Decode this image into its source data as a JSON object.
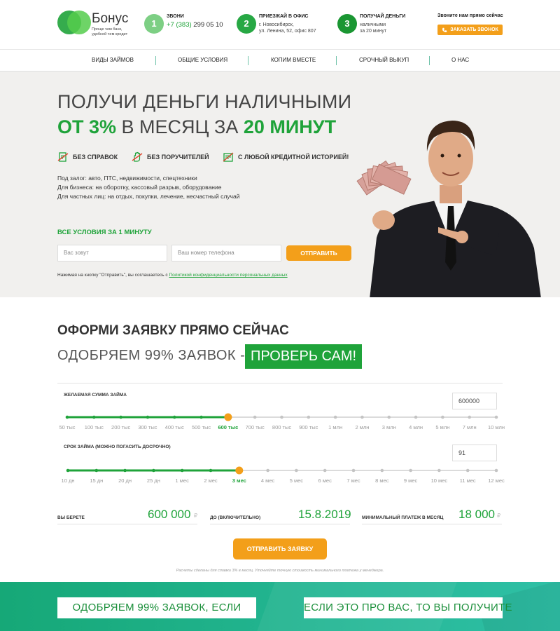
{
  "header": {
    "logo": {
      "name": "Бонус",
      "slogan": "Проще чем банк, удобней чем кредит"
    },
    "steps": [
      {
        "num": "1",
        "title": "ЗВОНИ",
        "phone_code": "+7 (383)",
        "phone_rest": " 299 05 10"
      },
      {
        "num": "2",
        "title": "ПРИЕЗЖАЙ В ОФИС",
        "line1": "г. Новосибирск,",
        "line2": "ул. Ленина, 52, офис 807"
      },
      {
        "num": "3",
        "title": "ПОЛУЧАЙ ДЕНЬГИ",
        "line1": "наличными",
        "line2": "за 20 минут"
      }
    ],
    "callbox": {
      "title": "Звоните нам прямо сейчас",
      "button": "ЗАКАЗАТЬ ЗВОНОК"
    },
    "colors": {
      "green": "#1fa33a",
      "orange": "#f39f1a"
    }
  },
  "nav": [
    "ВИДЫ ЗАЙМОВ",
    "ОБЩИЕ УСЛОВИЯ",
    "КОПИМ ВМЕСТЕ",
    "СРОЧНЫЙ ВЫКУП",
    "О НАС"
  ],
  "hero": {
    "line1": "ПОЛУЧИ ДЕНЬГИ НАЛИЧНЫМИ",
    "line2_a": "ОТ 3%",
    "line2_b": " В МЕСЯЦ ЗА ",
    "line2_c": "20 МИНУТ",
    "features": [
      "БЕЗ СПРАВОК",
      "БЕЗ ПОРУЧИТЕЛЕЙ",
      "С ЛЮБОЙ КРЕДИТНОЙ ИСТОРИЕЙ!"
    ],
    "lines": [
      "Под залог: авто, ПТС, недвижимости, спецтехники",
      "Для бизнеса: на оборотку, кассовый разрыв, оборудование",
      "Для частных лиц: на отдых, покупки, лечение, несчастный случай"
    ],
    "conditions": "ВСЕ УСЛОВИЯ ЗА 1 МИНУТУ",
    "name_placeholder": "Вас зовут",
    "phone_placeholder": "Ваш номер телефона",
    "submit": "ОТПРАВИТЬ",
    "agree_text": "Нажимая на кнопку \"Отправить\", вы соглашаетесь с ",
    "agree_link": "Политикой конфиденциальности персональных данных"
  },
  "calc": {
    "title": "ОФОРМИ ЗАЯВКУ ПРЯМО СЕЙЧАС",
    "subtitle": "ОДОБРЯЕМ 99% ЗАЯВОК - ",
    "badge": "ПРОВЕРЬ САМ!",
    "amount": {
      "label": "ЖЕЛАЕМАЯ СУММА ЗАЙМА",
      "value": "600000",
      "ticks": [
        "50 тыс",
        "100 тыс",
        "200 тыс",
        "300 тыс",
        "400 тыс",
        "500 тыс",
        "600 тыс",
        "700 тыс",
        "800 тыс",
        "900 тыс",
        "1 млн",
        "2 млн",
        "3 млн",
        "4 млн",
        "5 млн",
        "7 млн",
        "10 млн"
      ],
      "selected_index": 6
    },
    "term": {
      "label": "СРОК ЗАЙМА (МОЖНО ПОГАСИТЬ ДОСРОЧНО)",
      "value": "91",
      "ticks": [
        "10 дн",
        "15 дн",
        "20 дн",
        "25 дн",
        "1 мес",
        "2 мес",
        "3 мес",
        "4 мес",
        "5 мес",
        "6 мес",
        "7 мес",
        "8 мес",
        "9 мес",
        "10 мес",
        "11 мес",
        "12 мес"
      ],
      "selected_index": 6
    },
    "results": [
      {
        "label": "ВЫ БЕРЕТЕ",
        "value": "600 000",
        "currency": "₽"
      },
      {
        "label": "ДО (ВКЛЮЧИТЕЛЬНО)",
        "value": "15.8.2019",
        "currency": ""
      },
      {
        "label": "МИНИМАЛЬНЫЙ ПЛАТЕЖ В МЕСЯЦ",
        "value": "18 000",
        "currency": "₽"
      }
    ],
    "apply": "ОТПРАВИТЬ ЗАЯВКУ",
    "note": "Расчеты сделаны для ставки 3% в месяц. Уточняйте точную стоимость минимального платежа у менеджера."
  },
  "band": {
    "left": "ОДОБРЯЕМ 99% ЗАЯВОК, ЕСЛИ",
    "right": "ЕСЛИ ЭТО ПРО ВАС, ТО ВЫ ПОЛУЧИТЕ"
  }
}
